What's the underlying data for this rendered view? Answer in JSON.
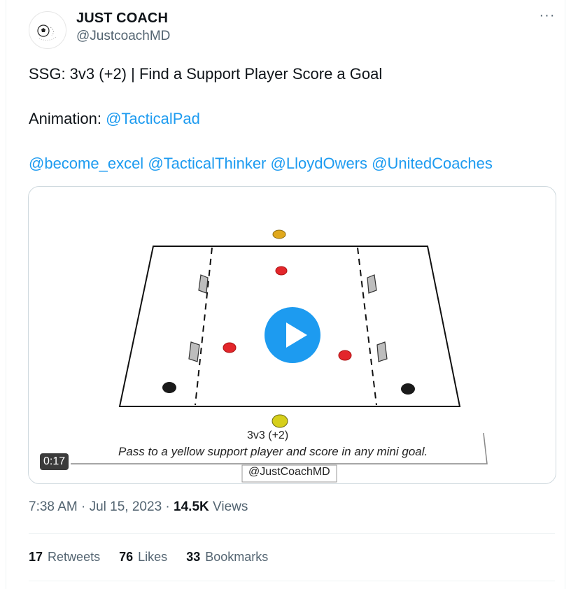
{
  "tweet": {
    "author": {
      "display_name": "JUST COACH",
      "handle": "@JustcoachMD"
    },
    "more_icon": "more-horizontal-icon",
    "text_line1": "SSG: 3v3 (+2) | Find a Support Player Score a Goal",
    "animation_prefix": "Animation: ",
    "animation_mention": "@TacticalPad",
    "mentions": [
      "@become_excel",
      "@TacticalThinker",
      "@LloydOwers",
      "@UnitedCoaches"
    ],
    "media": {
      "duration": "0:17",
      "drill_title": "3v3 (+2)",
      "drill_description": "Pass to a yellow support player and score in any mini goal.",
      "drill_credit": "@JustCoachMD",
      "play_icon": "play-icon",
      "accent": "#1d9bf0"
    },
    "meta": {
      "time": "7:38 AM",
      "separator": " · ",
      "date": "Jul 15, 2023",
      "views_count": "14.5K",
      "views_label": " Views"
    },
    "stats": {
      "retweets_count": "17",
      "retweets_label": "Retweets",
      "likes_count": "76",
      "likes_label": "Likes",
      "bookmarks_count": "33",
      "bookmarks_label": "Bookmarks"
    },
    "colors": {
      "link": "#1d9bf0",
      "secondary_text": "#536471",
      "red_player": "#e3262b",
      "yellow_player": "#d6cf1a",
      "black_player": "#1a1a1a"
    }
  }
}
